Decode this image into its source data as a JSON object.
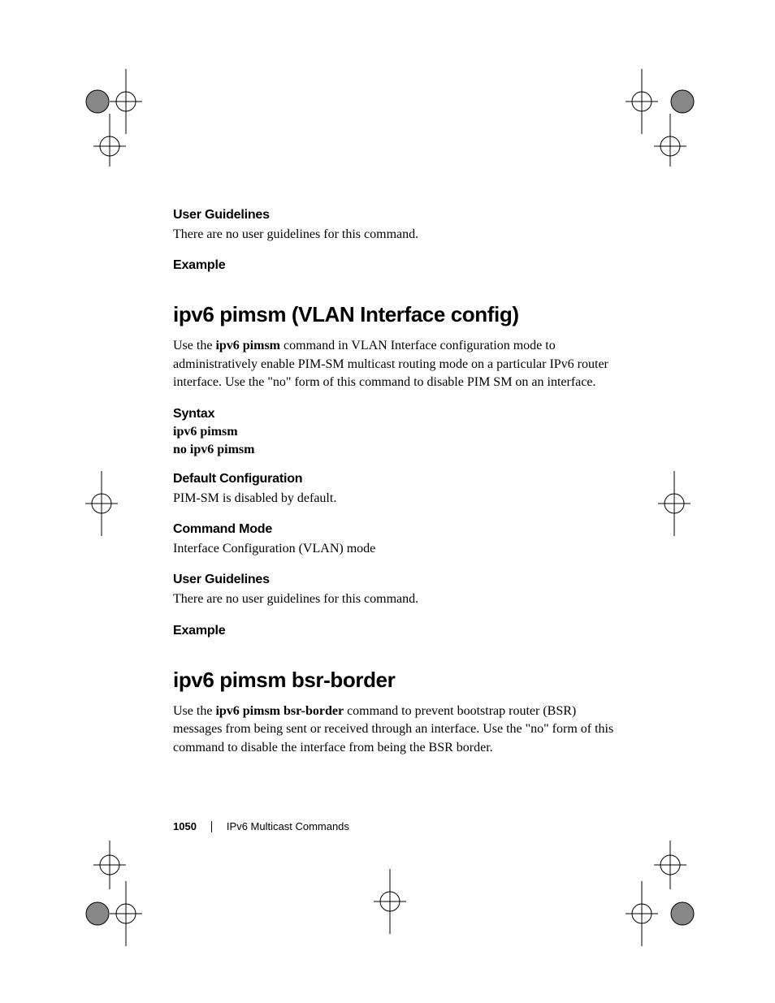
{
  "footer": {
    "page_number": "1050",
    "section_title": "IPv6 Multicast Commands"
  },
  "sections": {
    "ug_prev_head": "User Guidelines",
    "ug_prev_body": "There are no user guidelines for this command.",
    "ex_prev_head": "Example",
    "cmd1_title": "ipv6 pimsm (VLAN Interface config)",
    "cmd1_intro_pre": "Use the ",
    "cmd1_intro_bold": "ipv6 pimsm",
    "cmd1_intro_post": " command in VLAN Interface configuration mode to administratively enable PIM-SM multicast routing mode on a particular IPv6 router interface. Use the \"no\" form of this command to disable PIM SM on an interface.",
    "syntax_head": "Syntax",
    "cmd1_syntax1": "ipv6 pimsm",
    "cmd1_syntax2": "no ipv6 pimsm",
    "defcfg_head": "Default Configuration",
    "cmd1_defcfg_body": "PIM-SM is disabled by default.",
    "cmdmode_head": "Command Mode",
    "cmd1_mode_body": "Interface Configuration (VLAN) mode",
    "ug_head": "User Guidelines",
    "cmd1_ug_body": "There are no user guidelines for this command.",
    "ex_head": "Example",
    "cmd2_title": "ipv6 pimsm bsr-border",
    "cmd2_intro_pre": "Use the ",
    "cmd2_intro_bold": "ipv6 pimsm bsr-border",
    "cmd2_intro_post": " command to prevent bootstrap router (BSR) messages from being sent or received through an interface. Use the \"no\" form of this command to disable the interface from being the BSR border."
  }
}
